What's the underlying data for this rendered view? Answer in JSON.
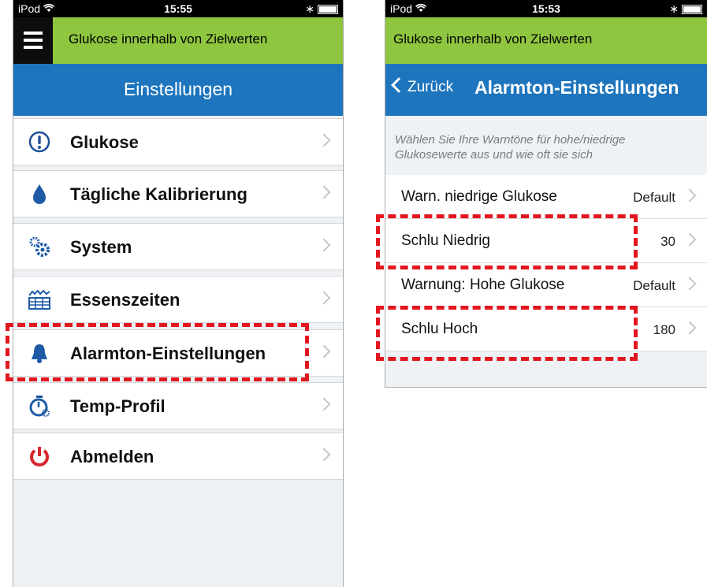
{
  "left": {
    "status": {
      "carrier": "iPod",
      "time": "15:55"
    },
    "banner": "Glukose innerhalb von Zielwerten",
    "nav_title": "Einstellungen",
    "menu": [
      {
        "label": "Glukose",
        "icon": "alert-circle-icon"
      },
      {
        "label": "Tägliche Kalibrierung",
        "icon": "drop-icon"
      },
      {
        "label": "System",
        "icon": "gears-icon"
      },
      {
        "label": "Essenszeiten",
        "icon": "meal-chart-icon"
      },
      {
        "label": "Alarmton-Einstellungen",
        "icon": "bell-icon"
      },
      {
        "label": "Temp-Profil",
        "icon": "stopwatch-icon"
      },
      {
        "label": "Abmelden",
        "icon": "power-icon"
      }
    ]
  },
  "right": {
    "status": {
      "carrier": "iPod",
      "time": "15:53"
    },
    "banner": "Glukose innerhalb von Zielwerten",
    "back_label": "Zurück",
    "nav_title": "Alarmton-Einstellungen",
    "hint": "Wählen Sie Ihre Warntöne für hohe/niedrige Glukosewerte aus und wie oft sie sich",
    "rows": [
      {
        "label": "Warn. niedrige Glukose",
        "value": "Default"
      },
      {
        "label": "Schlu Niedrig",
        "value": "30"
      },
      {
        "label": "Warnung: Hohe Glukose",
        "value": "Default"
      },
      {
        "label": "Schlu Hoch",
        "value": "180"
      }
    ]
  },
  "colors": {
    "accent_blue": "#1e75bd",
    "banner_green": "#8ec63f",
    "highlight_red": "#e3161f"
  }
}
